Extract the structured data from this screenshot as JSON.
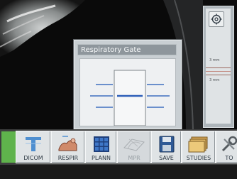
{
  "dialog": {
    "title": "Respiratory Gate"
  },
  "side_panel": {
    "label_upper": "3 mm",
    "label_lower": "3 mm"
  },
  "toolbar": {
    "buttons": [
      {
        "label": "DICOM",
        "icon": "dicom-icon",
        "enabled": true
      },
      {
        "label": "RESPIR",
        "icon": "respiration-icon",
        "enabled": true
      },
      {
        "label": "PLANN",
        "icon": "planning-grid-icon",
        "enabled": true
      },
      {
        "label": "MPR",
        "icon": "mpr-icon",
        "enabled": false
      },
      {
        "label": "SAVE",
        "icon": "floppy-disk-icon",
        "enabled": true
      },
      {
        "label": "STUDIES",
        "icon": "studies-folder-icon",
        "enabled": true
      },
      {
        "label": "TO",
        "icon": "tools-icon",
        "enabled": true
      }
    ]
  },
  "colors": {
    "accent_green": "#5fb34c",
    "gate_line": "#3f6fc0",
    "panel_gray": "#dfe3e5"
  }
}
